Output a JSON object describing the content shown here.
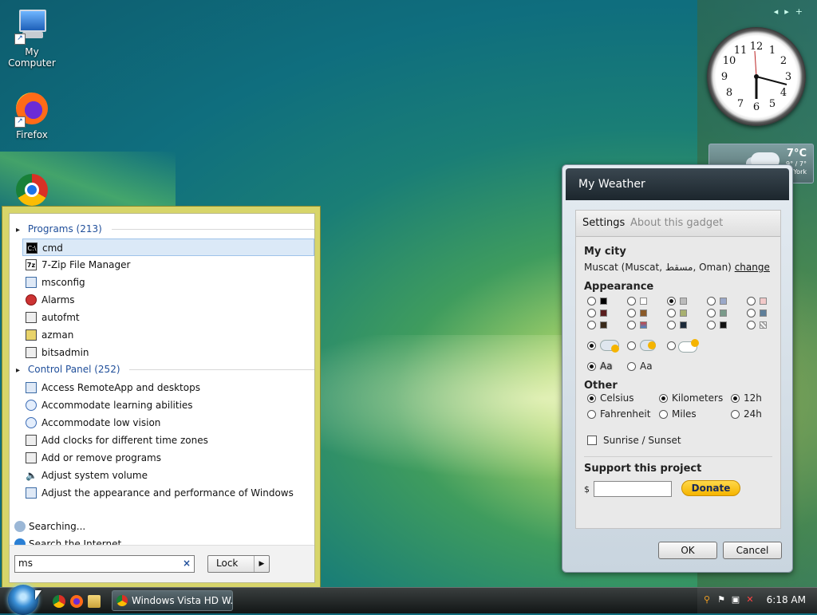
{
  "desktop": {
    "icons": [
      {
        "label": "My Computer"
      },
      {
        "label": "Firefox"
      },
      {
        "label": "Chrome"
      }
    ]
  },
  "start_menu": {
    "programs_header": "Programs (213)",
    "programs": [
      "cmd",
      "7-Zip File Manager",
      "msconfig",
      "Alarms",
      "autofmt",
      "azman",
      "bitsadmin"
    ],
    "control_panel_header": "Control Panel (252)",
    "control_panel": [
      "Access RemoteApp and desktops",
      "Accommodate learning abilities",
      "Accommodate low vision",
      "Add clocks for different time zones",
      "Add or remove programs",
      "Adjust system volume",
      "Adjust the appearance and performance of Windows"
    ],
    "searching": "Searching...",
    "search_internet": "Search the Internet",
    "search_value": "ms",
    "search_clear": "×",
    "lock_label": "Lock"
  },
  "clock": {
    "numerals": [
      "12",
      "1",
      "2",
      "3",
      "4",
      "5",
      "6",
      "7",
      "8",
      "9",
      "10",
      "11"
    ]
  },
  "weather_mini": {
    "temp": "7°C",
    "hilo": "9° / 7°",
    "city": "New York"
  },
  "dialog": {
    "title": "My Weather",
    "tab_settings": "Settings",
    "tab_about": "About this gadget",
    "my_city_label": "My city",
    "city_value": "Muscat (Muscat, مسقط, Oman)",
    "change_link": "change",
    "appearance_label": "Appearance",
    "font_option": "Aa",
    "other_label": "Other",
    "celsius": "Celsius",
    "fahrenheit": "Fahrenheit",
    "kilometers": "Kilometers",
    "miles": "Miles",
    "h12": "12h",
    "h24": "24h",
    "sunrise": "Sunrise / Sunset",
    "support_label": "Support this project",
    "currency": "$",
    "donate": "Donate",
    "ok": "OK",
    "cancel": "Cancel"
  },
  "taskbar": {
    "task_title": "Windows Vista HD W...",
    "time": "6:18 AM"
  },
  "colors": {
    "dialog_title_bg": "#1c262d",
    "startmenu_frame": "#d7d56a",
    "donate": "#f5b400"
  }
}
